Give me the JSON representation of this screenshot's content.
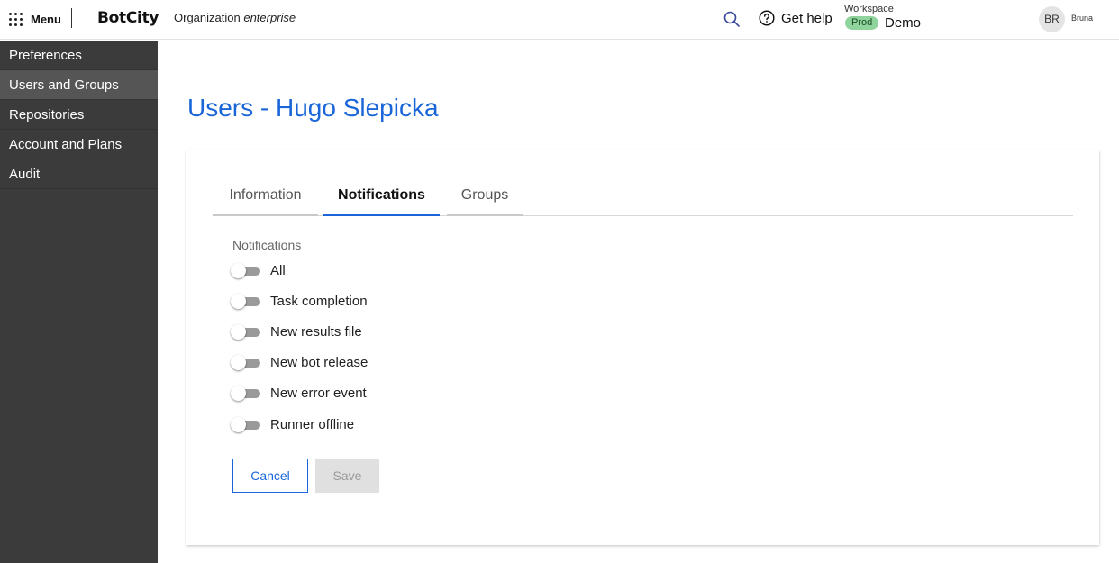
{
  "header": {
    "menu_label": "Menu",
    "brand": "BotCity",
    "org_prefix": "Organization",
    "org_name": "enterprise",
    "help_label": "Get help",
    "workspace": {
      "label": "Workspace",
      "badge": "Prod",
      "name": "Demo"
    },
    "user": {
      "initials": "BR",
      "name": "Bruna"
    }
  },
  "sidebar": {
    "items": [
      {
        "label": "Preferences"
      },
      {
        "label": "Users and Groups",
        "active": true
      },
      {
        "label": "Repositories"
      },
      {
        "label": "Account and Plans"
      },
      {
        "label": "Audit"
      }
    ]
  },
  "main": {
    "title": "Users - Hugo Slepicka",
    "tabs": [
      {
        "label": "Information"
      },
      {
        "label": "Notifications",
        "active": true
      },
      {
        "label": "Groups"
      }
    ],
    "notifications": {
      "heading": "Notifications",
      "items": [
        {
          "label": "All",
          "enabled": false
        },
        {
          "label": "Task completion",
          "enabled": false
        },
        {
          "label": "New results file",
          "enabled": false
        },
        {
          "label": "New bot release",
          "enabled": false
        },
        {
          "label": "New error event",
          "enabled": false
        },
        {
          "label": "Runner offline",
          "enabled": false
        }
      ]
    },
    "buttons": {
      "cancel": "Cancel",
      "save": "Save"
    }
  },
  "colors": {
    "accent": "#1a66d9",
    "sidebar_bg": "#3b3b3b",
    "sidebar_active": "#555555",
    "prod_badge": "#8fd49c"
  }
}
